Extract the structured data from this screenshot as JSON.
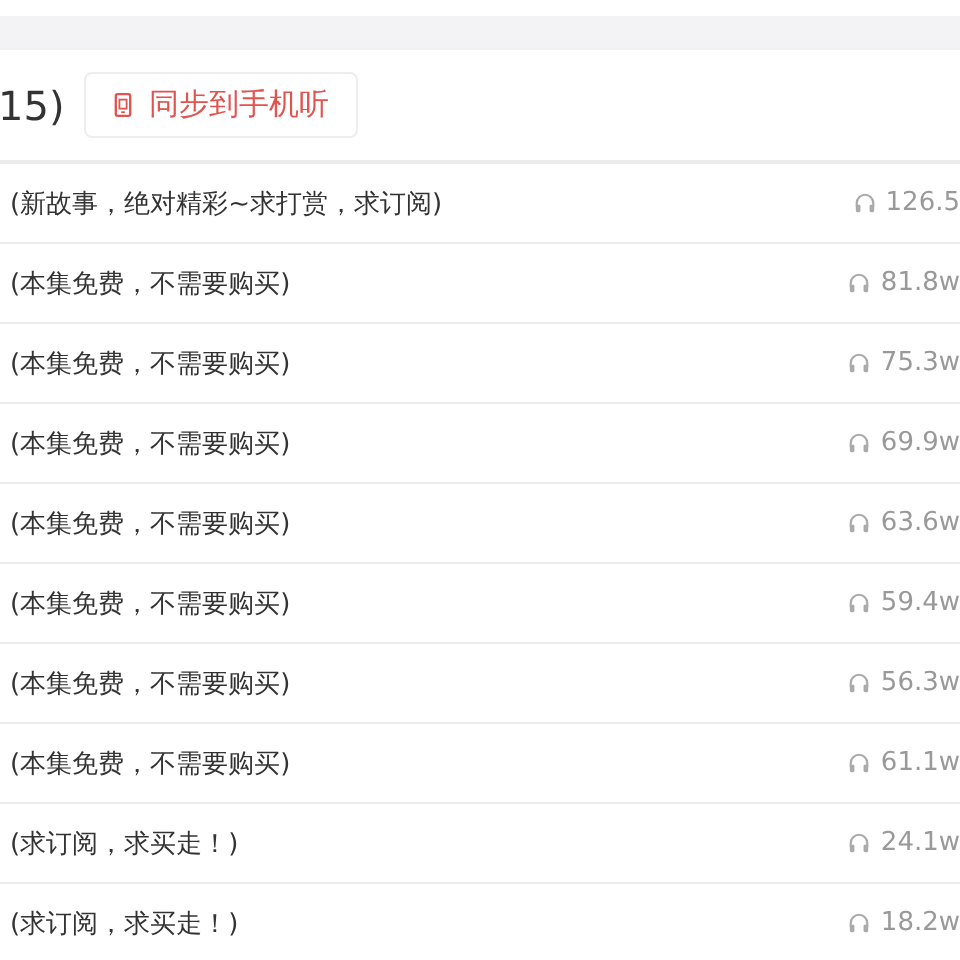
{
  "header": {
    "count_tail": "15)",
    "sync_button": "同步到手机听"
  },
  "episodes": [
    {
      "title": "(新故事，绝对精彩~求打赏，求订阅)",
      "plays": "126.5"
    },
    {
      "title": "(本集免费，不需要购买)",
      "plays": "81.8w"
    },
    {
      "title": "(本集免费，不需要购买)",
      "plays": "75.3w"
    },
    {
      "title": "(本集免费，不需要购买)",
      "plays": "69.9w"
    },
    {
      "title": "(本集免费，不需要购买)",
      "plays": "63.6w"
    },
    {
      "title": "(本集免费，不需要购买)",
      "plays": "59.4w"
    },
    {
      "title": "(本集免费，不需要购买)",
      "plays": "56.3w"
    },
    {
      "title": "(本集免费，不需要购买)",
      "plays": "61.1w"
    },
    {
      "title": "(求订阅，求买走！)",
      "plays": "24.1w"
    },
    {
      "title": "(求订阅，求买走！)",
      "plays": "18.2w"
    }
  ]
}
